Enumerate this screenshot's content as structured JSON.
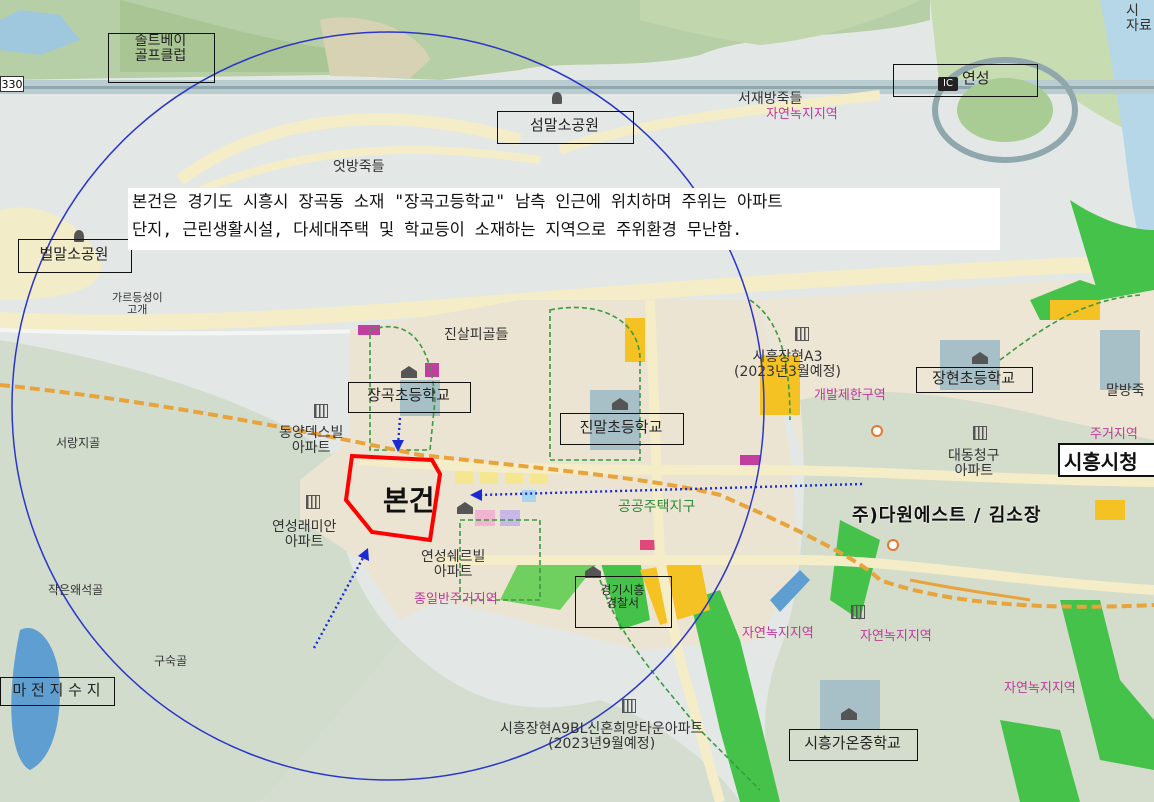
{
  "map": {
    "note_lines": [
      "본건은 경기도 시흥시 장곡동 소재 \"장곡고등학교\" 남측 인근에 위치하며 주위는 아파트",
      "단지, 근린생활시설, 다세대주택 및 학교등이 소재하는 지역으로 주위환경 무난함."
    ],
    "subject_label": "본건",
    "city_hall": "시흥시청",
    "company": "주)다원에스트 / 김소장",
    "road_number": "330",
    "ic_badge": "IC",
    "boxed": {
      "golf": "솔트베이\n골프클럽",
      "ic": "연성",
      "seommal_park": "섬말소공원",
      "beolmal_park": "벌말소공원",
      "janggok_elem": "장곡초등학교",
      "jinmal_elem": "진말초등학교",
      "janghyeon_elem": "장현초등학교",
      "police": "경기시흥\n경찰서",
      "reservoir": "마 전 지 수 지",
      "gaon_mid": "시흥가온중학교"
    },
    "labels": {
      "seojaebang": "서재방죽들",
      "nature1": "자연녹지지역",
      "eotbang": "엇방죽들",
      "gareudeung": "가르등성이\n고개",
      "jinsalpi": "진살피골들",
      "seorang": "서랑지골",
      "dongyang": "동양덱스빌\n아파트",
      "yeonseong_raemian": "연성래미안\n아파트",
      "yeonseong_shell": "연성쉐르빌\n아파트",
      "residential": "종일반주거지역",
      "jakeunoe": "작은왜석골",
      "gusuk": "구숙골",
      "a9bl": "시흥장현A9BL신혼희망타운아파트\n(2023년9월예정)",
      "a3": "시흥장현A3\n(2023년3월예정)",
      "gaebal": "개발제한구역",
      "daedong": "대동청구\n아파트",
      "public_housing": "공공주택지구",
      "nature2": "자연녹지지역",
      "nature3": "자연녹지지역",
      "nature4": "자연녹지지역",
      "malbang": "말방죽",
      "jugeo": "주거지역",
      "topright": "시\n자료"
    }
  }
}
